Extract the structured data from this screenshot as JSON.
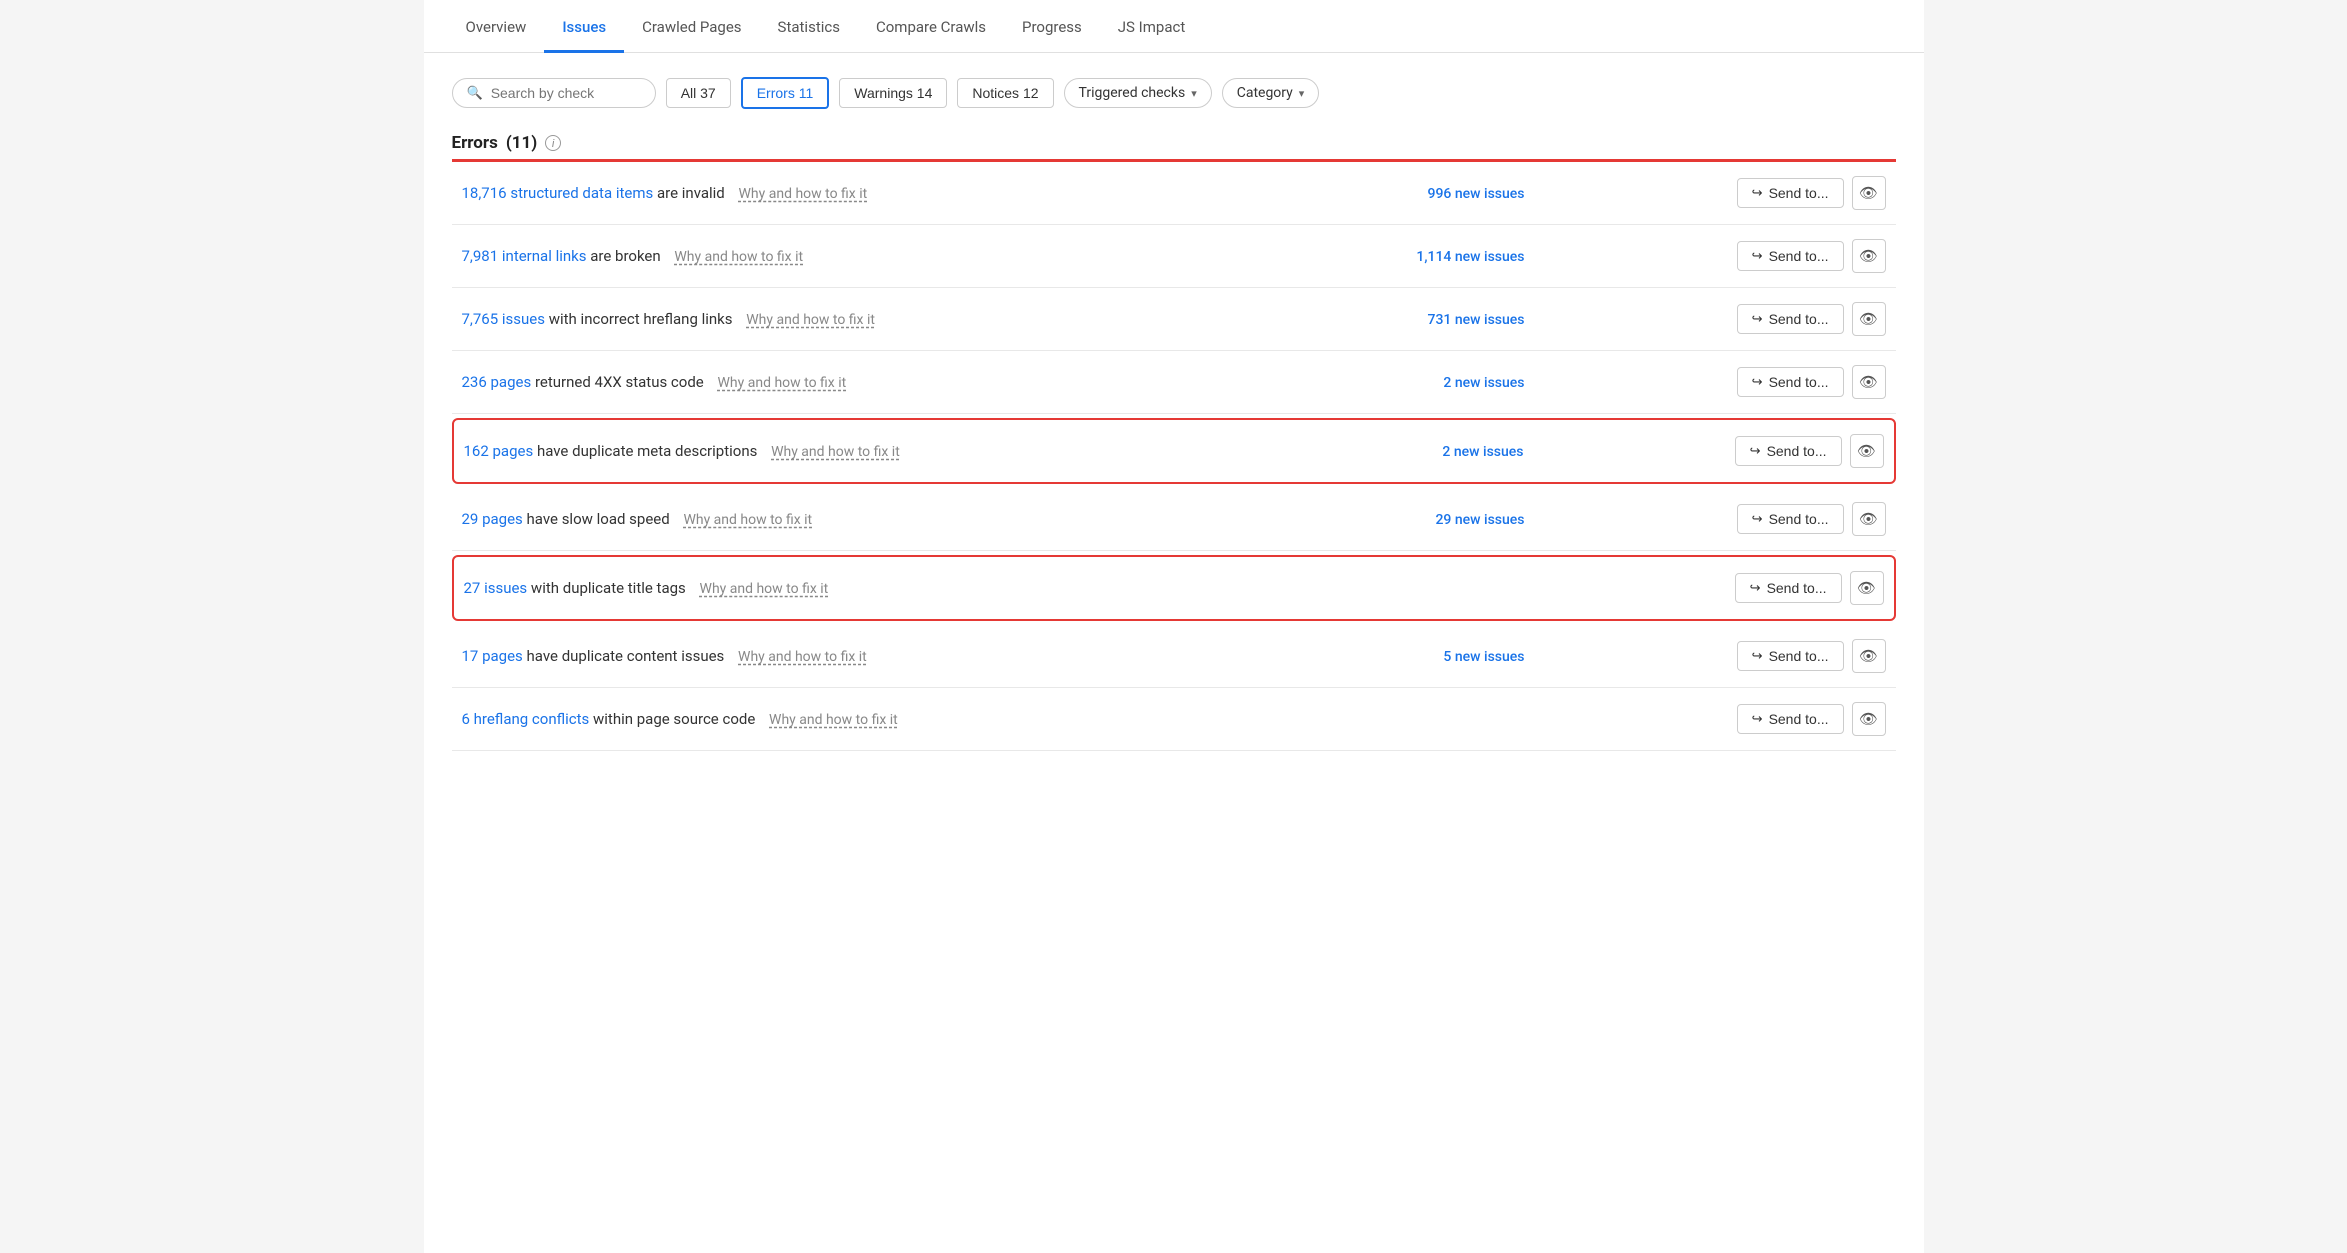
{
  "nav": {
    "items": [
      {
        "label": "Overview",
        "active": false
      },
      {
        "label": "Issues",
        "active": true
      },
      {
        "label": "Crawled Pages",
        "active": false
      },
      {
        "label": "Statistics",
        "active": false
      },
      {
        "label": "Compare Crawls",
        "active": false
      },
      {
        "label": "Progress",
        "active": false
      },
      {
        "label": "JS Impact",
        "active": false
      }
    ]
  },
  "filters": {
    "search_placeholder": "Search by check",
    "all_label": "All",
    "all_count": "37",
    "errors_label": "Errors",
    "errors_count": "11",
    "warnings_label": "Warnings",
    "warnings_count": "14",
    "notices_label": "Notices",
    "notices_count": "12",
    "triggered_label": "Triggered checks",
    "category_label": "Category"
  },
  "section": {
    "title": "Errors",
    "count": "(11)"
  },
  "issues": [
    {
      "id": 1,
      "link_text": "18,716 structured data items",
      "description": "are invalid",
      "why_text": "Why and how to fix it",
      "new_issues": "996 new issues",
      "highlighted": false
    },
    {
      "id": 2,
      "link_text": "7,981 internal links",
      "description": "are broken",
      "why_text": "Why and how to fix it",
      "new_issues": "1,114 new issues",
      "highlighted": false
    },
    {
      "id": 3,
      "link_text": "7,765 issues",
      "description": "with incorrect hreflang links",
      "why_text": "Why and how to fix it",
      "new_issues": "731 new issues",
      "highlighted": false
    },
    {
      "id": 4,
      "link_text": "236 pages",
      "description": "returned 4XX status code",
      "why_text": "Why and how to fix it",
      "new_issues": "2 new issues",
      "highlighted": false
    },
    {
      "id": 5,
      "link_text": "162 pages",
      "description": "have duplicate meta descriptions",
      "why_text": "Why and how to fix it",
      "new_issues": "2 new issues",
      "highlighted": true
    },
    {
      "id": 6,
      "link_text": "29 pages",
      "description": "have slow load speed",
      "why_text": "Why and how to fix it",
      "new_issues": "29 new issues",
      "highlighted": false
    },
    {
      "id": 7,
      "link_text": "27 issues",
      "description": "with duplicate title tags",
      "why_text": "Why and how to fix it",
      "new_issues": "",
      "highlighted": true
    },
    {
      "id": 8,
      "link_text": "17 pages",
      "description": "have duplicate content issues",
      "why_text": "Why and how to fix it",
      "new_issues": "5 new issues",
      "highlighted": false
    },
    {
      "id": 9,
      "link_text": "6 hreflang conflicts",
      "description": "within page source code",
      "why_text": "Why and how to fix it",
      "new_issues": "",
      "highlighted": false
    }
  ],
  "buttons": {
    "send_to": "Send to...",
    "eye_symbol": "👁"
  }
}
